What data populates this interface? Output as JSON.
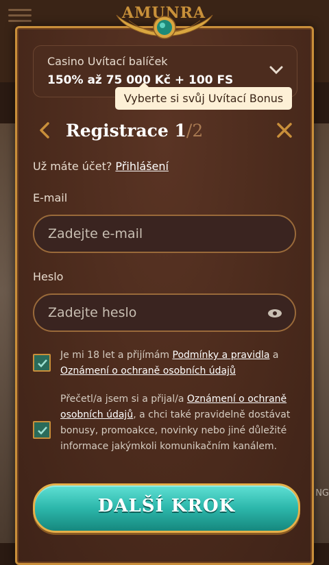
{
  "bonus": {
    "title": "Casino Uvítací balíček",
    "value": "150% až 75 000 Kč + 100 FS",
    "tooltip": "Vyberte si svůj Uvítací Bonus"
  },
  "registration": {
    "title": "Registrace ",
    "step": "1",
    "total": "/2",
    "have_account": "Už máte účet? ",
    "login_link": "Přihlášení"
  },
  "email": {
    "label": "E-mail",
    "placeholder": "Zadejte e-mail"
  },
  "password": {
    "label": "Heslo",
    "placeholder": "Zadejte heslo"
  },
  "consents": {
    "age": {
      "text1": "Je mi 18 let a přijímám ",
      "link1": "Podmínky a pravidla",
      "text2": " a ",
      "link2": "Oznámení o ochraně osobních údajů"
    },
    "marketing": {
      "text1": "Přečetl/a jsem si a přijal/a ",
      "link1": "Oznámení o ochraně osobních údajů",
      "text2": ", a chci také pravidelně dostávat bonusy, promoakce, novinky nebo jiné důležité informace jakýmkoli komunikačním kanálem."
    }
  },
  "next_button": "DALŠÍ KROK",
  "background": {
    "logo": "AMUNRA",
    "right_text": "NG"
  },
  "colors": {
    "accent_gold": "#c98f3a",
    "button_teal": "#2cb7ab",
    "checkbox_green": "#2a6b5a",
    "modal_brown": "#4a2a1c"
  },
  "icons": {
    "back": "chevron-left-icon",
    "close": "close-icon",
    "dropdown": "chevron-down-icon",
    "eye": "eye-icon",
    "check": "check-icon",
    "menu": "hamburger-icon"
  }
}
